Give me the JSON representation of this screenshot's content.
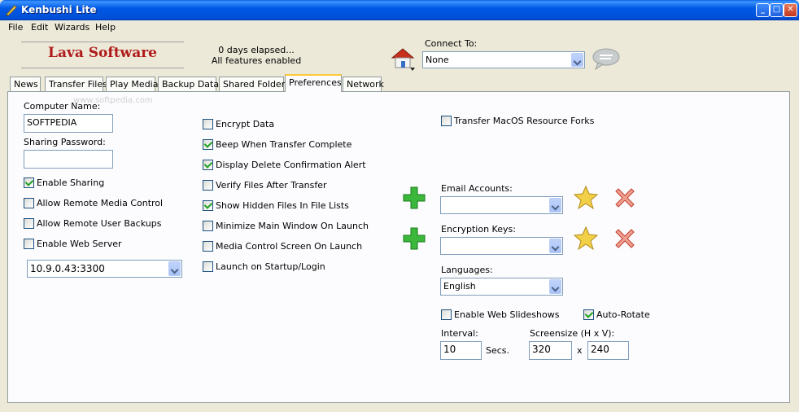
{
  "window": {
    "title": "Kenbushi Lite"
  },
  "menu": [
    "File",
    "Edit",
    "Wizards",
    "Help"
  ],
  "header": {
    "logo": "Lava Software",
    "status_line1": "0 days elapsed...",
    "status_line2": "All features enabled",
    "connect_label": "Connect To:",
    "connect_value": "None"
  },
  "tabs": [
    "News",
    "Transfer Files",
    "Play Media",
    "Backup Data",
    "Shared Folders",
    "Preferences",
    "Network"
  ],
  "watermark": "www.softpedia.com",
  "left": {
    "computer_name_label": "Computer Name:",
    "computer_name_value": "SOFTPEDIA",
    "sharing_password_label": "Sharing Password:",
    "sharing_password_value": "",
    "options": [
      {
        "label": "Enable Sharing",
        "checked": true
      },
      {
        "label": "Allow Remote Media Control",
        "checked": false
      },
      {
        "label": "Allow Remote User Backups",
        "checked": false
      },
      {
        "label": "Enable Web Server",
        "checked": false
      }
    ],
    "server_address": "10.9.0.43:3300"
  },
  "middle": {
    "options": [
      {
        "label": "Encrypt Data",
        "checked": false
      },
      {
        "label": "Beep When Transfer Complete",
        "checked": true
      },
      {
        "label": "Display Delete Confirmation Alert",
        "checked": true
      },
      {
        "label": "Verify Files After Transfer",
        "checked": false
      },
      {
        "label": "Show Hidden Files In File Lists",
        "checked": true
      },
      {
        "label": "Minimize Main Window On Launch",
        "checked": false
      },
      {
        "label": "Media Control Screen On Launch",
        "checked": false
      },
      {
        "label": "Launch on Startup/Login",
        "checked": false
      }
    ]
  },
  "right": {
    "macos_forks": {
      "label": "Transfer MacOS Resource Forks",
      "checked": false
    },
    "email_accounts_label": "Email Accounts:",
    "email_accounts_value": "",
    "encryption_keys_label": "Encryption Keys:",
    "encryption_keys_value": "",
    "languages_label": "Languages:",
    "languages_value": "English",
    "web_slideshows": {
      "label": "Enable Web Slideshows",
      "checked": false
    },
    "auto_rotate": {
      "label": "Auto-Rotate",
      "checked": true
    },
    "interval_label": "Interval:",
    "interval_value": "10",
    "interval_unit": "Secs.",
    "screensize_label": "Screensize (H x V):",
    "screen_h": "320",
    "screen_x": "x",
    "screen_v": "240"
  }
}
